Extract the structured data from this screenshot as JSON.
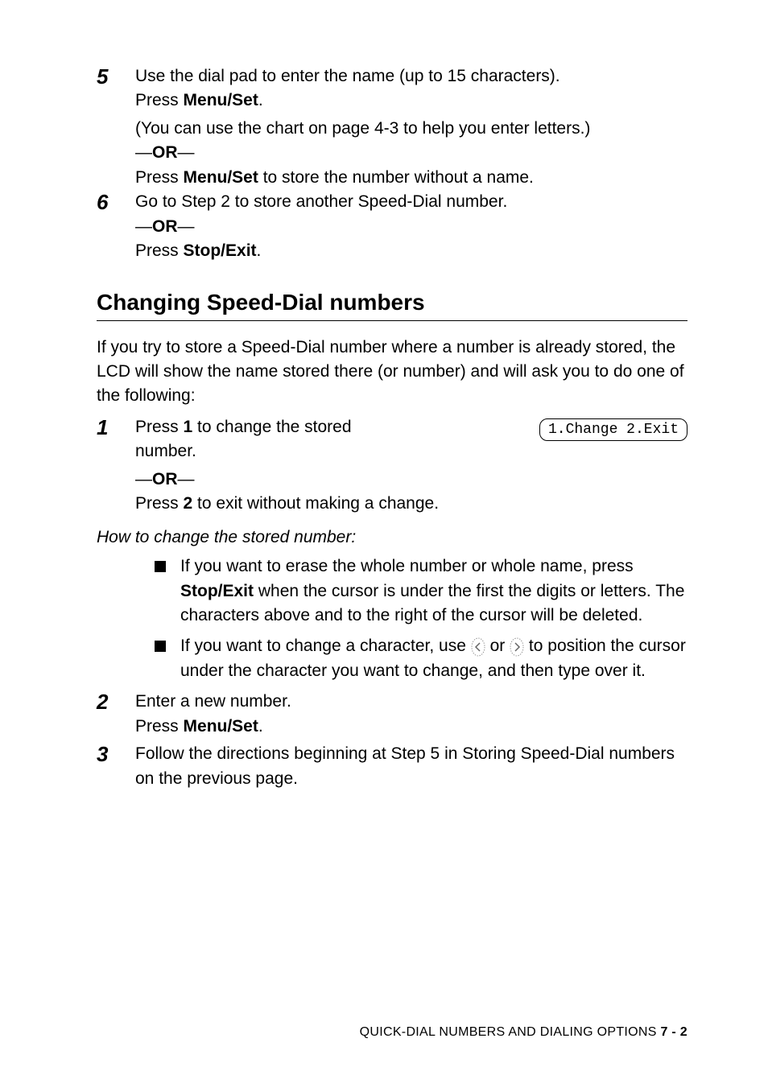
{
  "step5": {
    "num": "5",
    "line1a": "Use the dial pad to enter the name (up to 15 characters).",
    "line1b_press": "Press ",
    "line1b_bold": "Menu/Set",
    "line1b_tail": ".",
    "line2": "(You can use the chart on page 4-3 to help you enter letters.)",
    "or": "OR",
    "line3_press": "Press ",
    "line3_bold": "Menu/Set",
    "line3_tail": " to store the number without a name."
  },
  "step6": {
    "num": "6",
    "line1": "Go to Step 2 to store another Speed-Dial number.",
    "or": "OR",
    "line2_press": "Press ",
    "line2_bold": "Stop/Exit",
    "line2_tail": "."
  },
  "heading": "Changing Speed-Dial numbers",
  "intro": "If you try to store a Speed-Dial number where a number is already stored, the LCD will show the name stored there (or number) and will ask you to do one of the following:",
  "lcd": "1.Change 2.Exit",
  "step1": {
    "num": "1",
    "line1a": "Press ",
    "line1a_bold": "1",
    "line1a_tail": " to change the stored number.",
    "or": "OR",
    "line2a": "Press ",
    "line2a_bold": "2",
    "line2a_tail": " to exit without making a change."
  },
  "howto": "How to change the stored number:",
  "bullet1_a": "If you want to erase the whole number or whole name, press ",
  "bullet1_bold": "Stop/Exit",
  "bullet1_b": " when the cursor is under the first the digits or letters. The characters above and to the right of the cursor will be deleted.",
  "bullet2_a": "If you want to change a character, use ",
  "bullet2_mid": " or ",
  "bullet2_b": " to position the cursor under the character you want to change, and then type over it.",
  "step2": {
    "num": "2",
    "line1": "Enter a new number.",
    "line2_press": "Press ",
    "line2_bold": "Menu/Set",
    "line2_tail": "."
  },
  "step3": {
    "num": "3",
    "line1": "Follow the directions beginning at Step 5 in Storing Speed-Dial numbers on the previous page."
  },
  "footer_text": "QUICK-DIAL NUMBERS AND DIALING OPTIONS   ",
  "footer_page": "7 - 2"
}
